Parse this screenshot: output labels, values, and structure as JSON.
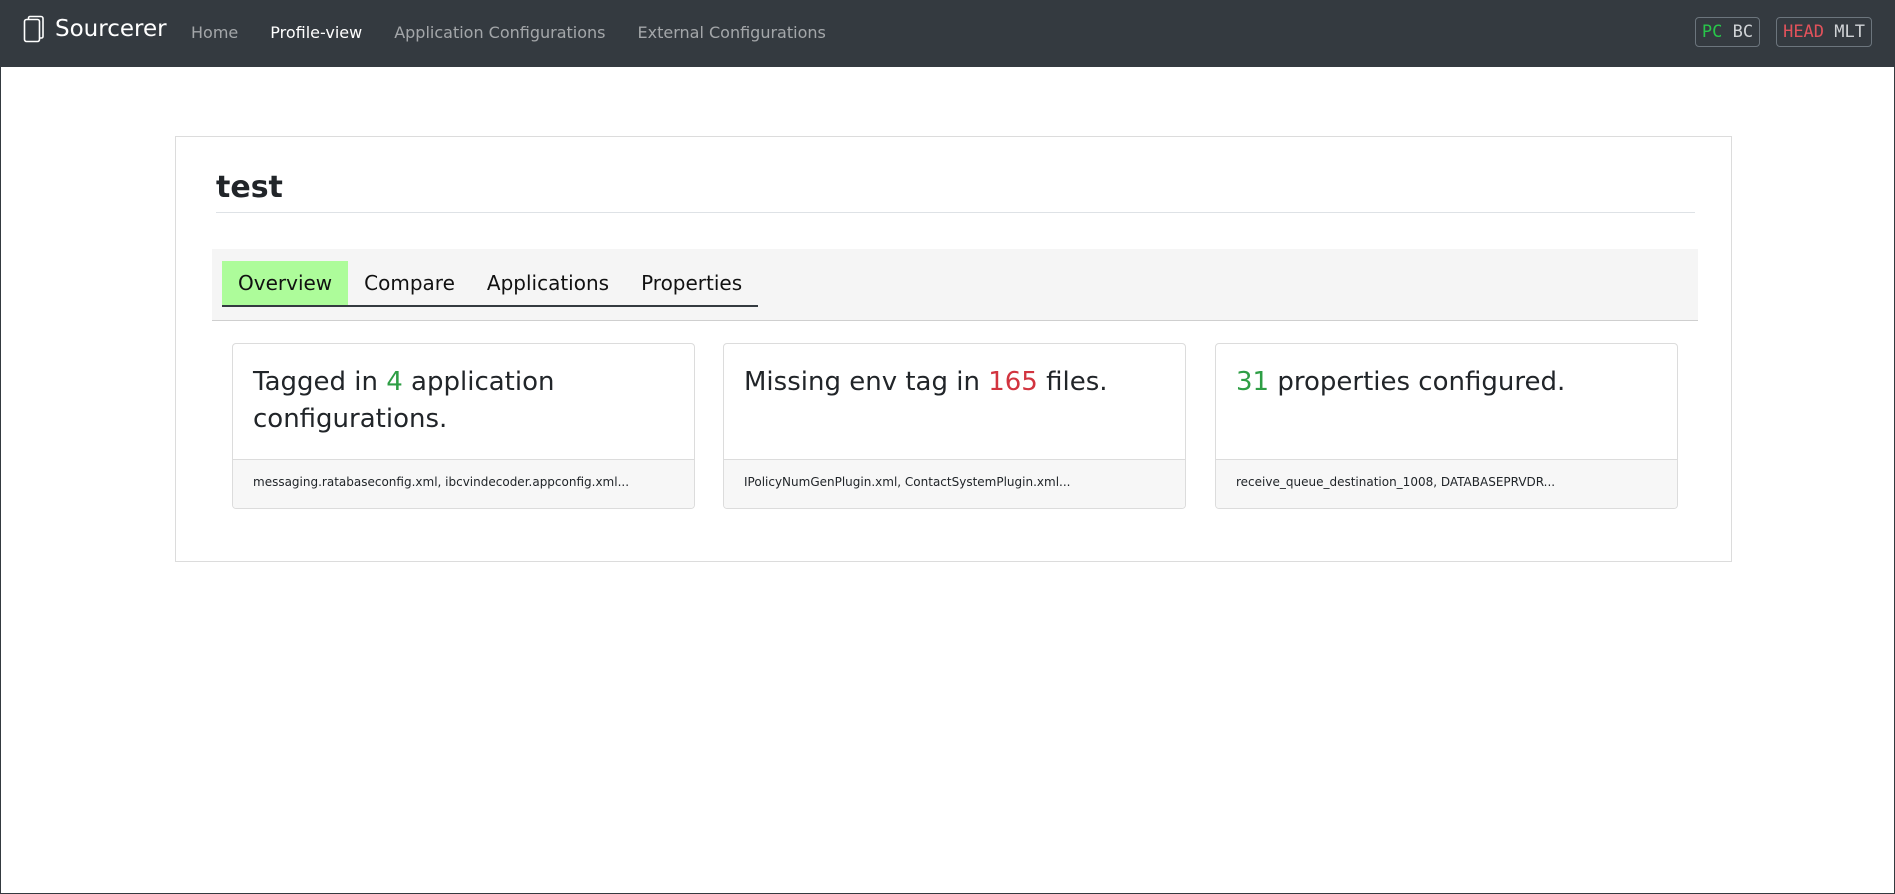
{
  "navbar": {
    "brand": "Sourcerer",
    "links": [
      {
        "label": "Home",
        "active": false
      },
      {
        "label": "Profile-view",
        "active": true
      },
      {
        "label": "Application Configurations",
        "active": false
      },
      {
        "label": "External Configurations",
        "active": false
      }
    ],
    "badges": [
      {
        "part1": "PC",
        "part2": "BC",
        "part1_color": "#28c64a"
      },
      {
        "part1": "HEAD",
        "part2": "MLT",
        "part1_color": "#e2525b"
      }
    ]
  },
  "profile": {
    "title": "test"
  },
  "tabs": [
    {
      "label": "Overview",
      "active": true
    },
    {
      "label": "Compare",
      "active": false
    },
    {
      "label": "Applications",
      "active": false
    },
    {
      "label": "Properties",
      "active": false
    }
  ],
  "cards": [
    {
      "prefix": "Tagged in ",
      "number": "4",
      "number_color": "#2e9e45",
      "suffix": " application configurations.",
      "footer": "messaging.ratabaseconfig.xml, ibcvindecoder.appconfig.xml..."
    },
    {
      "prefix": "Missing env tag in ",
      "number": "165",
      "number_color": "#d2343f",
      "suffix": " files.",
      "footer": "IPolicyNumGenPlugin.xml, ContactSystemPlugin.xml..."
    },
    {
      "prefix": "",
      "number": "31",
      "number_color": "#2e9e45",
      "suffix": " properties configured.",
      "footer": "receive_queue_destination_1008, DATABASEPRVDR..."
    }
  ]
}
